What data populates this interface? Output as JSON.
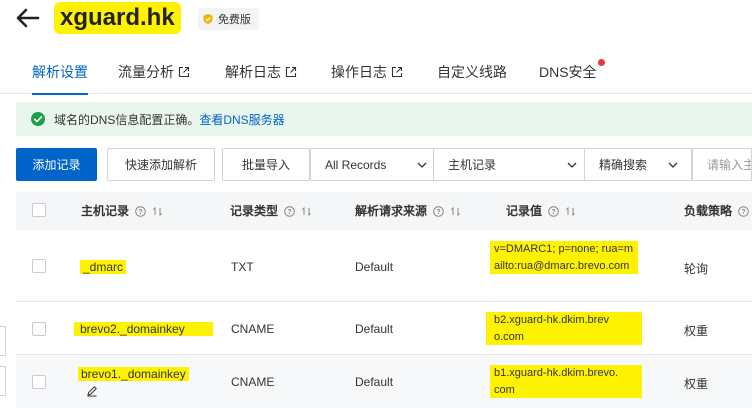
{
  "header": {
    "domain": "xguard.hk",
    "plan_badge": "免费版"
  },
  "tabs": [
    {
      "label": "解析设置",
      "active": true
    },
    {
      "label": "流量分析",
      "external": true
    },
    {
      "label": "解析日志",
      "external": true
    },
    {
      "label": "操作日志",
      "external": true
    },
    {
      "label": "自定义线路"
    },
    {
      "label": "DNS安全",
      "dot": true
    }
  ],
  "notice": {
    "text": "域名的DNS信息配置正确。",
    "link": "查看DNS服务器"
  },
  "toolbar": {
    "add_record": "添加记录",
    "quick_add": "快速添加解析",
    "batch_import": "批量导入",
    "record_filter": "All Records",
    "search_field": "主机记录",
    "match_mode": "精确搜索",
    "search_placeholder": "请输入主机记录"
  },
  "table": {
    "columns": [
      "主机记录",
      "记录类型",
      "解析请求来源",
      "记录值",
      "负载策略"
    ],
    "rows": [
      {
        "host": "_dmarc",
        "type": "TXT",
        "source": "Default",
        "value": "v=DMARC1; p=none; rua=mailto:rua@dmarc.brevo.com",
        "strategy": "轮询"
      },
      {
        "host": "brevo2._domainkey",
        "type": "CNAME",
        "source": "Default",
        "value": "b2.xguard-hk.dkim.brevo.com",
        "strategy": "权重"
      },
      {
        "host": "brevo1._domainkey",
        "type": "CNAME",
        "source": "Default",
        "value": "b1.xguard-hk.dkim.brevo.com",
        "strategy": "权重"
      }
    ]
  },
  "colors": {
    "accent": "#0064c8",
    "highlight": "#fff200",
    "notice_bg": "#e9f6ee",
    "success": "#1e9e4b",
    "alert_dot": "#e4393c"
  }
}
